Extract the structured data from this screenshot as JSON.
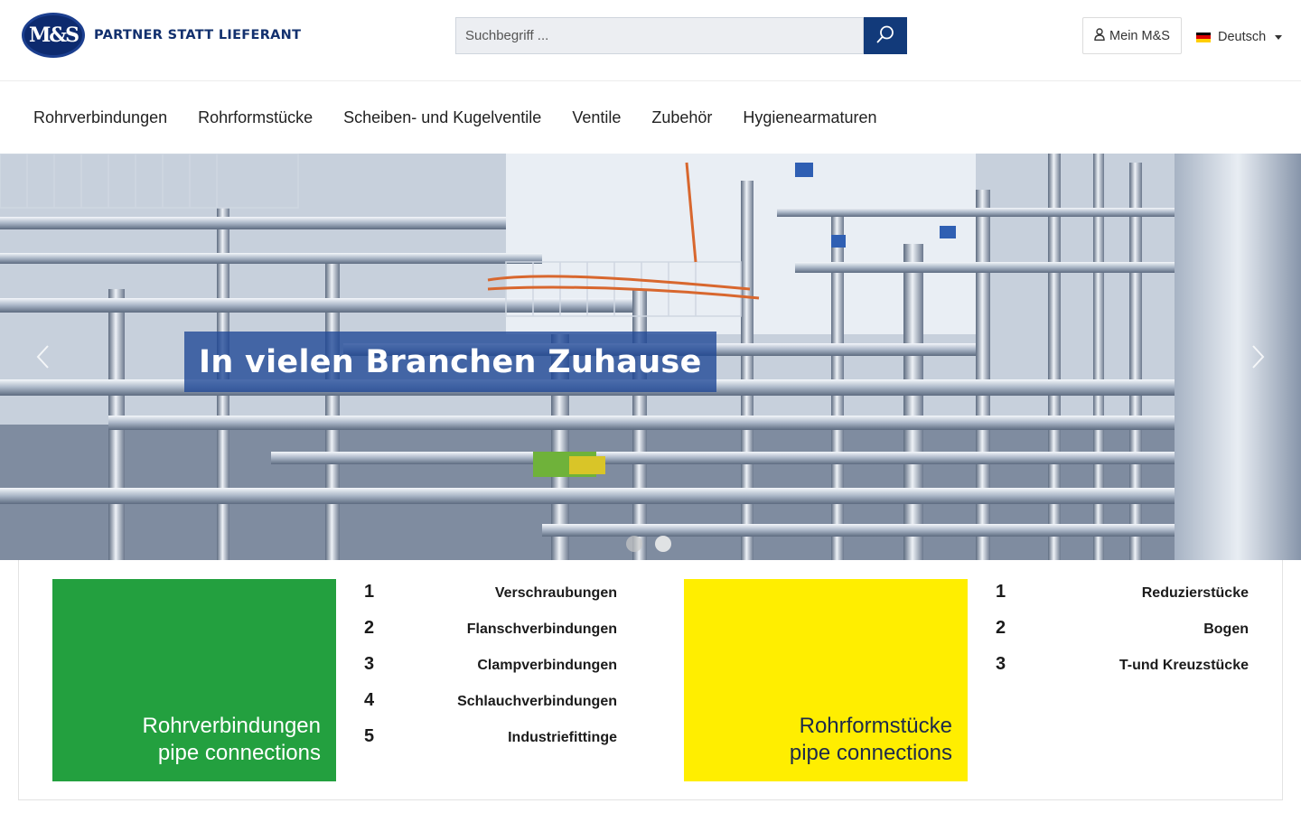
{
  "brand": {
    "logo_text": "M&S",
    "tagline": "PARTNER STATT LIEFERANT",
    "primary_color": "#123a7a"
  },
  "search": {
    "placeholder": "Suchbegriff ...",
    "value": "",
    "button_icon": "search-icon"
  },
  "account": {
    "label": "Mein M&S",
    "icon": "user-icon"
  },
  "language": {
    "selected": "Deutsch",
    "flag": "flag-de-icon"
  },
  "nav": {
    "items": [
      {
        "label": "Rohrverbindungen"
      },
      {
        "label": "Rohrformstücke"
      },
      {
        "label": "Scheiben- und Kugelventile"
      },
      {
        "label": "Ventile"
      },
      {
        "label": "Zubehör"
      },
      {
        "label": "Hygienearmaturen"
      }
    ]
  },
  "hero": {
    "caption": "In vielen Branchen Zuhause",
    "prev_icon": "chevron-left-icon",
    "next_icon": "chevron-right-icon",
    "slide_count": 2,
    "active_slide": 2
  },
  "categories": [
    {
      "title": "Rohrverbindungen",
      "subtitle": "pipe connections",
      "color": "#23a03f",
      "items": [
        {
          "num": "1",
          "label": "Verschraubungen"
        },
        {
          "num": "2",
          "label": "Flanschverbindungen"
        },
        {
          "num": "3",
          "label": "Clampverbindungen"
        },
        {
          "num": "4",
          "label": "Schlauchverbindungen"
        },
        {
          "num": "5",
          "label": "Industriefittinge"
        }
      ]
    },
    {
      "title": "Rohrformstücke",
      "subtitle": "pipe connections",
      "color": "#ffee00",
      "items": [
        {
          "num": "1",
          "label": "Reduzierstücke"
        },
        {
          "num": "2",
          "label": "Bogen"
        },
        {
          "num": "3",
          "label": "T-und Kreuzstücke"
        }
      ]
    }
  ]
}
